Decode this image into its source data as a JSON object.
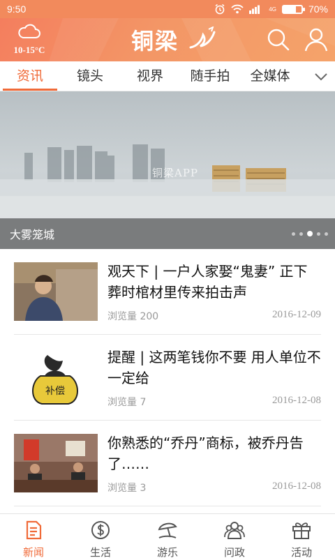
{
  "status": {
    "time": "9:50",
    "network": "4G",
    "battery": "70%",
    "battery_level": 0.7
  },
  "header": {
    "temperature": "10-15°C",
    "logo_text": "铜梁"
  },
  "tabs": [
    {
      "label": "资讯",
      "active": true
    },
    {
      "label": "镜头",
      "active": false
    },
    {
      "label": "视界",
      "active": false
    },
    {
      "label": "随手拍",
      "active": false
    },
    {
      "label": "全媒体",
      "active": false
    }
  ],
  "banner": {
    "caption": "大雾笼城",
    "watermark": "铜梁APP",
    "slide_count": 5,
    "active_slide": 3
  },
  "news": [
    {
      "title": "观天下 | 一户人家娶“鬼妻” 正下葬时棺材里传来拍击声",
      "views": "浏览量 200",
      "date": "2016-12-09"
    },
    {
      "title": "提醒 | 这两笔钱你不要 用人单位不一定给",
      "views": "浏览量 7",
      "date": "2016-12-08",
      "thumb_text": "补偿"
    },
    {
      "title": "你熟悉的“乔丹”商标，被乔丹告了……",
      "views": "浏览量 3",
      "date": "2016-12-08"
    }
  ],
  "bottom_nav": [
    {
      "label": "新闻",
      "icon": "news-icon",
      "active": true
    },
    {
      "label": "生活",
      "icon": "dollar-coin-icon",
      "active": false
    },
    {
      "label": "游乐",
      "icon": "beach-umbrella-icon",
      "active": false
    },
    {
      "label": "问政",
      "icon": "people-icon",
      "active": false
    },
    {
      "label": "活动",
      "icon": "gift-icon",
      "active": false
    }
  ],
  "colors": {
    "accent": "#f06a38",
    "header": "#f39666",
    "muted": "#999999"
  }
}
